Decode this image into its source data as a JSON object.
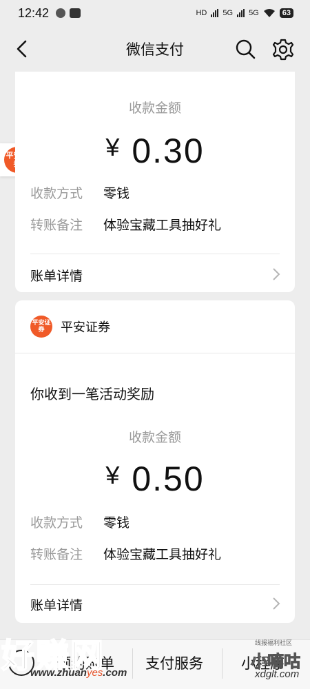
{
  "status_bar": {
    "time": "12:42",
    "network1": "HD",
    "network2": "5G",
    "network3": "5G",
    "battery": "63"
  },
  "nav": {
    "title": "微信支付",
    "icons": [
      "back-arrow-icon",
      "search-icon",
      "gear-icon"
    ]
  },
  "floating_badge": {
    "text": "平安证券"
  },
  "card1": {
    "amount_label": "收款金额",
    "currency": "¥",
    "amount": "0.30",
    "rows": [
      {
        "key": "收款方式",
        "value": "零钱"
      },
      {
        "key": "转账备注",
        "value": "体验宝藏工具抽好礼"
      }
    ],
    "detail_link": "账单详情"
  },
  "card2": {
    "sender_logo": "平安证券",
    "sender_name": "平安证券",
    "headline": "你收到一笔活动奖励",
    "amount_label": "收款金额",
    "currency": "¥",
    "amount": "0.50",
    "rows": [
      {
        "key": "收款方式",
        "value": "零钱"
      },
      {
        "key": "转账备注",
        "value": "体验宝藏工具抽好礼"
      }
    ],
    "detail_link": "账单详情"
  },
  "bottom_bar": {
    "tabs": [
      "预约账单",
      "支付服务",
      "小程序"
    ]
  },
  "watermarks": {
    "left_big": "好赚网",
    "left_url_a": "www.zhuan",
    "left_url_b": "yes",
    "left_url_c": ".com",
    "right_small": "线报福利社区",
    "right_big": "小嘀咕",
    "right_url": "xdglt.com"
  },
  "colors": {
    "page_bg": "#ededed",
    "card_bg": "#ffffff",
    "muted_text": "#9a9a9a",
    "brand_orange": "#f05a28"
  }
}
